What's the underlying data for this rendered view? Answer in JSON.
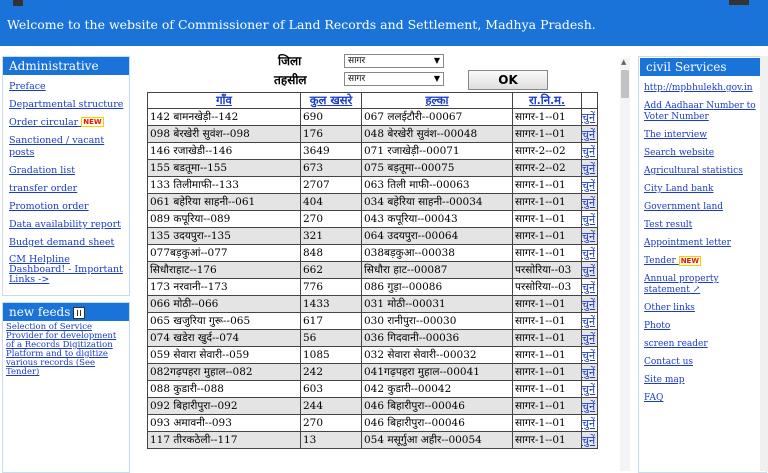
{
  "header": {
    "welcome": "Welcome to the website of Commissioner of Land Records and Settlement, Madhya Pradesh."
  },
  "administrative": {
    "title": "Administrative",
    "items": [
      "Preface",
      "Departmental structure",
      "Order circular",
      "Sanctioned / vacant posts",
      "Gradation list",
      "transfer order",
      "Promotion order",
      "Data availability report",
      "Budget demand sheet",
      "CM Helpline Dashboard! - Important Links ->"
    ],
    "new_tag": "NEW"
  },
  "news": {
    "title": "new feeds",
    "text": "Selection of Service Provider for development of a Records Digitization Platform and to digitize various records (See Tender)"
  },
  "form": {
    "district_label": "जिला",
    "district_value": "सागर",
    "tehsil_label": "तहसील",
    "tehsil_value": "सागर",
    "ok_label": "OK"
  },
  "table": {
    "headers": [
      "गाँव",
      "कुल खसरे",
      "हल्का",
      "रा.नि.म."
    ],
    "choose_label": "चुनें",
    "rows": [
      [
        "142 बामनखेड़ी--142",
        "690",
        "067 ललईटौरी--00067",
        "सागर-1--01"
      ],
      [
        "098 बेरखेरी सुवंश--098",
        "176",
        "048 बेरखेरी सुवंश--00048",
        "सागर-1--01"
      ],
      [
        "146 रजाखेडी--146",
        "3649",
        "071 रजाखेड़ी--00071",
        "सागर-2--02"
      ],
      [
        "155 बडतूमा--155",
        "673",
        "075 बड़तूमा--00075",
        "सागर-2--02"
      ],
      [
        "133 तिलीमाफी--133",
        "2707",
        "063 तिली माफी--00063",
        "सागर-1--01"
      ],
      [
        "061 बहेरिया साहनी--061",
        "404",
        "034 बहेरिया साहनी--00034",
        "सागर-1--01"
      ],
      [
        "089 कपूरिया--089",
        "270",
        "043 कपूरिया--00043",
        "सागर-1--01"
      ],
      [
        "135 उदयपुरा--135",
        "321",
        "064 उदयपुरा--00064",
        "सागर-1--01"
      ],
      [
        "077बड़कुआं--077",
        "848",
        "038बड़कुआ--00038",
        "सागर-1--01"
      ],
      [
        "सिधौराहाट--176",
        "662",
        "सिधौरा हाट--00087",
        "परसोरिया--03"
      ],
      [
        "173 नरवानी--173",
        "776",
        "086 गुड़ा--00086",
        "परसोरिया--03"
      ],
      [
        "066 मोठी--066",
        "1433",
        "031 मोठी--00031",
        "सागर-1--01"
      ],
      [
        "065 खजुरिया गुरू--065",
        "617",
        "030 रानीपुरा--00030",
        "सागर-1--01"
      ],
      [
        "074 खडेरा खुर्द--074",
        "56",
        "036 गिदवानी--00036",
        "सागर-1--01"
      ],
      [
        "059 सेवारा सेवारी--059",
        "1085",
        "032 सेवारा सेवारी--00032",
        "सागर-1--01"
      ],
      [
        "082गढ़पहरा मुहाल--082",
        "242",
        "041गढ़पहरा मुहाल--00041",
        "सागर-1--01"
      ],
      [
        "088 कुडारी--088",
        "603",
        "042 कुडारी--00042",
        "सागर-1--01"
      ],
      [
        "092 बिहारीपुरा--092",
        "244",
        "046 बिहारीपुरा--00046",
        "सागर-1--01"
      ],
      [
        "093 अमावनी--093",
        "270",
        "046 बिहारीपुरा--00046",
        "सागर-1--01"
      ],
      [
        "117 तीरकठेली--117",
        "13",
        "054 मसूर्गुआ अहीर--00054",
        "सागर-1--01"
      ]
    ]
  },
  "civil_services": {
    "title": "civil Services",
    "items": [
      "http://mpbhulekh.gov.in",
      "Add Aadhaar Number to Voter Number",
      "The interview",
      "Search website",
      "Agricultural statistics",
      "City Land bank",
      "Government land",
      "Test result",
      "Appointment letter",
      "Tender",
      "Annual property statement",
      "Other links",
      "Photo",
      "screen reader",
      "Contact us",
      "Site map",
      "FAQ"
    ],
    "new_tag": "NEW"
  },
  "colors": {
    "banner": "#1a73d9",
    "link": "#1a3cc8",
    "row_alt": "#e4e4e4"
  }
}
